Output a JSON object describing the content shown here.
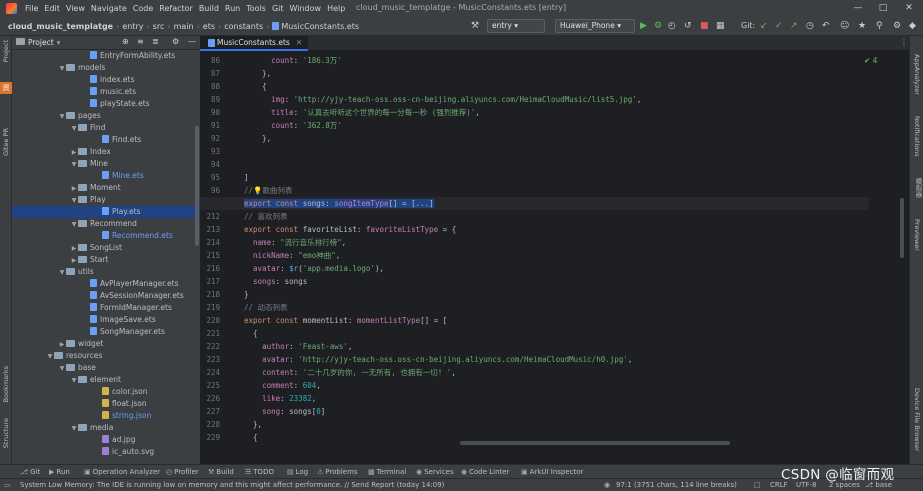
{
  "menubar": {
    "items": [
      "File",
      "Edit",
      "View",
      "Navigate",
      "Code",
      "Refactor",
      "Build",
      "Run",
      "Tools",
      "Git",
      "Window",
      "Help"
    ],
    "window_title": "cloud_music_templatge - MusicConstants.ets [entry]"
  },
  "navbar": {
    "breadcrumbs": [
      "cloud_music_templatge",
      "entry",
      "src",
      "main",
      "ets",
      "constants",
      "MusicConstants.ets"
    ],
    "module_combo": "entry",
    "device_combo": "Huawei_Phone",
    "git_label": "Git:"
  },
  "left_strip": {
    "labels": [
      "Project",
      "Gitee PR",
      "Bookmarks",
      "Structure"
    ],
    "badge": "资"
  },
  "right_strip": {
    "labels": [
      "AppAnalyzer",
      "Notifications",
      "模拟器",
      "Previewer",
      "Device File Browser"
    ]
  },
  "project_panel": {
    "title": "Project",
    "tree": [
      {
        "label": "EntryFormAbility.ets",
        "indent": 7,
        "kind": "ets",
        "arrow": ""
      },
      {
        "label": "models",
        "indent": 5,
        "kind": "folder",
        "arrow": "down"
      },
      {
        "label": "index.ets",
        "indent": 7,
        "kind": "ets",
        "arrow": ""
      },
      {
        "label": "music.ets",
        "indent": 7,
        "kind": "ets",
        "arrow": ""
      },
      {
        "label": "playState.ets",
        "indent": 7,
        "kind": "ets",
        "arrow": ""
      },
      {
        "label": "pages",
        "indent": 5,
        "kind": "folder",
        "arrow": "down"
      },
      {
        "label": "Find",
        "indent": 6,
        "kind": "folder",
        "arrow": "down"
      },
      {
        "label": "Find.ets",
        "indent": 8,
        "kind": "ets",
        "arrow": ""
      },
      {
        "label": "Index",
        "indent": 6,
        "kind": "folder",
        "arrow": "right"
      },
      {
        "label": "Mine",
        "indent": 6,
        "kind": "folder",
        "arrow": "down"
      },
      {
        "label": "Mine.ets",
        "indent": 8,
        "kind": "ets",
        "arrow": "",
        "blue": true
      },
      {
        "label": "Moment",
        "indent": 6,
        "kind": "folder",
        "arrow": "right"
      },
      {
        "label": "Play",
        "indent": 6,
        "kind": "folder",
        "arrow": "down"
      },
      {
        "label": "Play.ets",
        "indent": 8,
        "kind": "ets",
        "arrow": "",
        "selected": true
      },
      {
        "label": "Recommend",
        "indent": 6,
        "kind": "folder",
        "arrow": "down"
      },
      {
        "label": "Recommend.ets",
        "indent": 8,
        "kind": "ets",
        "arrow": "",
        "blue": true
      },
      {
        "label": "SongList",
        "indent": 6,
        "kind": "folder",
        "arrow": "right"
      },
      {
        "label": "Start",
        "indent": 6,
        "kind": "folder",
        "arrow": "right"
      },
      {
        "label": "utils",
        "indent": 5,
        "kind": "folder",
        "arrow": "down"
      },
      {
        "label": "AvPlayerManager.ets",
        "indent": 7,
        "kind": "ets",
        "arrow": ""
      },
      {
        "label": "AvSessionManager.ets",
        "indent": 7,
        "kind": "ets",
        "arrow": ""
      },
      {
        "label": "FormIdManager.ets",
        "indent": 7,
        "kind": "ets",
        "arrow": ""
      },
      {
        "label": "ImageSave.ets",
        "indent": 7,
        "kind": "ets",
        "arrow": ""
      },
      {
        "label": "SongManager.ets",
        "indent": 7,
        "kind": "ets",
        "arrow": ""
      },
      {
        "label": "widget",
        "indent": 5,
        "kind": "folder",
        "arrow": "right"
      },
      {
        "label": "resources",
        "indent": 4,
        "kind": "folder",
        "arrow": "down"
      },
      {
        "label": "base",
        "indent": 5,
        "kind": "folder",
        "arrow": "down"
      },
      {
        "label": "element",
        "indent": 6,
        "kind": "folder",
        "arrow": "down"
      },
      {
        "label": "color.json",
        "indent": 8,
        "kind": "json",
        "arrow": ""
      },
      {
        "label": "float.json",
        "indent": 8,
        "kind": "json",
        "arrow": ""
      },
      {
        "label": "string.json",
        "indent": 8,
        "kind": "json",
        "arrow": "",
        "blue": true
      },
      {
        "label": "media",
        "indent": 6,
        "kind": "folder",
        "arrow": "down"
      },
      {
        "label": "ad.jpg",
        "indent": 8,
        "kind": "img",
        "arrow": ""
      },
      {
        "label": "ic_auto.svg",
        "indent": 8,
        "kind": "img",
        "arrow": ""
      }
    ]
  },
  "editor": {
    "tab_label": "MusicConstants.ets",
    "inspection": "✔ 4",
    "line_numbers": [
      "86",
      "87",
      "88",
      "89",
      "90",
      "91",
      "92",
      "93",
      "94",
      "95",
      "96",
      "97",
      "212",
      "213",
      "214",
      "215",
      "216",
      "217",
      "218",
      "219",
      "220",
      "221",
      "222",
      "223",
      "224",
      "225",
      "226",
      "227",
      "228",
      "229"
    ],
    "lines": [
      "      count: '186.3万'",
      "    },",
      "    {",
      "      img: 'http://yjy-teach-oss.oss-cn-beijing.aliyuncs.com/HeimaCloudMusic/list5.jpg',",
      "      title: '认真去听听这个世界的每一分每一秒 (强烈推荐)',",
      "      count: '362.8万'",
      "    },",
      "",
      "",
      "]",
      "//💡歌曲列表",
      "export const songs: songItemType[] = [...]",
      "// 喜欢列表",
      "export const favoriteList: favoriteListType = {",
      "  name: \"流行音乐排行榜\",",
      "  nickName: \"emo神曲\",",
      "  avatar: $r('app.media.logo'),",
      "  songs: songs",
      "}",
      "// 动态列表",
      "export const momentList: momentListType[] = [",
      "  {",
      "    author: 'Feast-aws',",
      "    avatar: 'http://yjy-teach-oss.oss-cn-beijing.aliyuncs.com/HeimaCloudMusic/h0.jpg',",
      "    content: '二十几岁的你, 一无所有, 也拥有一切! ',",
      "    comment: 604,",
      "    like: 23382,",
      "    song: songs[0]",
      "  },",
      "  {"
    ]
  },
  "bottom_tools": [
    "Git",
    "Run",
    "Operation Analyzer",
    "Profiler",
    "Build",
    "TODO",
    "Log",
    "Problems",
    "Terminal",
    "Services",
    "Code Linter",
    "ArkUI Inspector"
  ],
  "status": {
    "message": "System Low Memory: The IDE is running low on memory and this might affect performance. // Send Report (today 14:09)",
    "position": "97:1 (3751 chars, 114 line breaks)",
    "line_sep": "CRLF",
    "encoding": "UTF-8",
    "indent": "2 spaces",
    "branch": "base"
  },
  "watermark": "CSDN @临窗而观"
}
